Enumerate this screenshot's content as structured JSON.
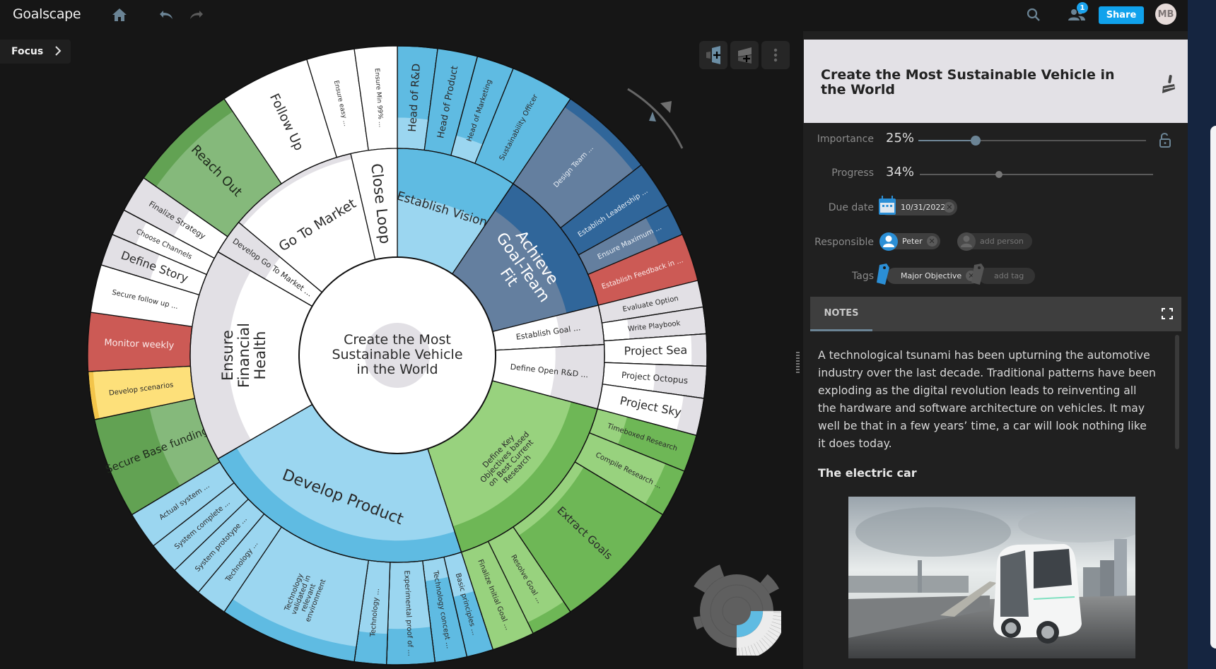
{
  "app": {
    "name": "Goalscape",
    "search_label": "Search",
    "collaborators_badge": "1",
    "share_label": "Share",
    "user_initials": "MB",
    "focus_label": "Focus"
  },
  "toolbar": {
    "add_sibling_label": "Add sibling goal",
    "add_child_label": "Add sub-goal",
    "more_label": "More options"
  },
  "colors": {
    "accent": "#10a2ec",
    "slider": "#6b8495",
    "panel_header": "#e3e1e6",
    "white_seg": "#ffffff",
    "grey_seg": "#e2e0e5",
    "lightblue": "#9bd6f0",
    "blue": "#5fbbe2",
    "steel": "#647f9f",
    "darksteel": "#30669a",
    "red": "#cc5a55",
    "yellow": "#fde07a",
    "yellow_dark": "#f3c54a",
    "green_light": "#98d27e",
    "green": "#6eb756",
    "green_mid": "#85b97b",
    "green_dark": "#62a253"
  },
  "chart_data": {
    "type": "sunburst",
    "title": "Create the Most Sustainable Vehicle in the World",
    "center": {
      "label": "Create the Most Sustainable Vehicle in the World",
      "progress": 34
    },
    "level1": [
      {
        "label": "Establish Vision",
        "start": 0,
        "end": 34,
        "fill": "#5fbbe2",
        "progress_fill": "#9bd6f0",
        "text": "#2a2a2a",
        "font": 17
      },
      {
        "label": "Achieve Goal-Team Fit",
        "start": 34,
        "end": 76,
        "fill": "#30669a",
        "progress_fill": "#647f9f",
        "text": "#ffffff",
        "font": 22
      },
      {
        "label": "Establish Goal ...",
        "start": 76,
        "end": 87,
        "fill": "#e2e0e5",
        "progress_fill": "#ffffff",
        "text": "#2a2a2a",
        "font": 11
      },
      {
        "label": "Define Open R&D ...",
        "start": 87,
        "end": 105,
        "fill": "#e2e0e5",
        "progress_fill": "#ffffff",
        "text": "#2a2a2a",
        "font": 11
      },
      {
        "label": "Define Key Objectives based on Best Current Research",
        "start": 105,
        "end": 162,
        "fill": "#6eb756",
        "progress_fill": "#98d27e",
        "text": "#2a2a2a",
        "font": 11
      },
      {
        "label": "Develop Product",
        "start": 162,
        "end": 240,
        "fill": "#5fbbe2",
        "progress_fill": "#9bd6f0",
        "text": "#2a2a2a",
        "font": 22
      },
      {
        "label": "Ensure Financial Health",
        "start": 240,
        "end": 300,
        "fill": "#e2e0e5",
        "progress_fill": "#ffffff",
        "text": "#2a2a2a",
        "font": 21
      },
      {
        "label": "Develop Go To Market ...",
        "start": 300,
        "end": 310,
        "fill": "#e2e0e5",
        "progress_fill": "#ffffff",
        "text": "#2a2a2a",
        "font": 11
      },
      {
        "label": "Go To Market",
        "start": 310,
        "end": 347,
        "fill": "#e2e0e5",
        "progress_fill": "#ffffff",
        "text": "#2a2a2a",
        "font": 19
      },
      {
        "label": "Close Loop",
        "start": 347,
        "end": 360,
        "fill": "#ffffff",
        "progress_fill": "#ffffff",
        "text": "#2a2a2a",
        "font": 21
      }
    ],
    "level2": [
      {
        "label": "Head of R&D",
        "start": 0,
        "end": 7.5,
        "fill": "#5fbbe2",
        "progress_fill": "#9bd6f0",
        "progress": 30,
        "text": "#2a2a2a",
        "font": 15
      },
      {
        "label": "Head of Product",
        "start": 7.5,
        "end": 15,
        "fill": "#5fbbe2",
        "progress_fill": "#9bd6f0",
        "progress": 0,
        "text": "#2a2a2a",
        "font": 13
      },
      {
        "label": "Head of Marketing",
        "start": 15,
        "end": 22,
        "fill": "#5fbbe2",
        "progress_fill": "#9bd6f0",
        "progress": 20,
        "text": "#2a2a2a",
        "font": 10
      },
      {
        "label": "Sustainability Officer",
        "start": 22,
        "end": 34,
        "fill": "#5fbbe2",
        "progress_fill": "#9bd6f0",
        "progress": 0,
        "text": "#2a2a2a",
        "font": 10
      },
      {
        "label": "Design Team ...",
        "start": 34,
        "end": 52,
        "fill": "#30669a",
        "progress_fill": "#647f9f",
        "progress": 90,
        "text": "#e8eef5",
        "font": 10
      },
      {
        "label": "Establish Leadership ...",
        "start": 52,
        "end": 61,
        "fill": "#30669a",
        "progress_fill": "#647f9f",
        "progress": 0,
        "text": "#e8eef5",
        "font": 10
      },
      {
        "label": "Ensure Maximum ...",
        "start": 61,
        "end": 67,
        "fill": "#30669a",
        "progress_fill": "#647f9f",
        "progress": 75,
        "text": "#e8eef5",
        "font": 10
      },
      {
        "label": "Establish Feedback in ...",
        "start": 67,
        "end": 76,
        "fill": "#cc5a55",
        "progress_fill": "#cc5a55",
        "progress": 0,
        "text": "#fbeaea",
        "font": 10
      },
      {
        "label": "Evaluate Option",
        "start": 76,
        "end": 81,
        "fill": "#e2e0e5",
        "progress_fill": "#ffffff",
        "progress": 0,
        "text": "#2a2a2a",
        "font": 10
      },
      {
        "label": "Write Playbook",
        "start": 81,
        "end": 86,
        "fill": "#e2e0e5",
        "progress_fill": "#ffffff",
        "progress": 25,
        "text": "#2a2a2a",
        "font": 10
      },
      {
        "label": "Project Sea",
        "start": 86,
        "end": 92,
        "fill": "#e2e0e5",
        "progress_fill": "#ffffff",
        "progress": 85,
        "text": "#2a2a2a",
        "font": 16
      },
      {
        "label": "Project Octopus",
        "start": 92,
        "end": 98,
        "fill": "#e2e0e5",
        "progress_fill": "#ffffff",
        "progress": 50,
        "text": "#2a2a2a",
        "font": 12
      },
      {
        "label": "Project Sky",
        "start": 98,
        "end": 105,
        "fill": "#e2e0e5",
        "progress_fill": "#ffffff",
        "progress": 80,
        "text": "#2a2a2a",
        "font": 16
      },
      {
        "label": "Timeboxed Research",
        "start": 105,
        "end": 112,
        "fill": "#6eb756",
        "progress_fill": "#98d27e",
        "progress": 30,
        "text": "#2a2a2a",
        "font": 10
      },
      {
        "label": "Compile Research ...",
        "start": 112,
        "end": 121,
        "fill": "#6eb756",
        "progress_fill": "#98d27e",
        "progress": 80,
        "text": "#2a2a2a",
        "font": 10
      },
      {
        "label": "Extract Goals",
        "start": 121,
        "end": 146,
        "fill": "#6eb756",
        "progress_fill": "#98d27e",
        "progress": 10,
        "text": "#2a2a2a",
        "font": 15
      },
      {
        "label": "Resolve Goal ...",
        "start": 146,
        "end": 154,
        "fill": "#6eb756",
        "progress_fill": "#98d27e",
        "progress": 88,
        "text": "#2a2a2a",
        "font": 10
      },
      {
        "label": "Finalize Initial Goal ...",
        "start": 154,
        "end": 162,
        "fill": "#98d27e",
        "progress_fill": "#98d27e",
        "progress": 100,
        "text": "#2a2a2a",
        "font": 10
      },
      {
        "label": "Basic principles ...",
        "start": 162,
        "end": 167,
        "fill": "#5fbbe2",
        "progress_fill": "#9bd6f0",
        "progress": 40,
        "text": "#2a2a2a",
        "font": 10
      },
      {
        "label": "Technology concept ...",
        "start": 167,
        "end": 173,
        "fill": "#5fbbe2",
        "progress_fill": "#9bd6f0",
        "progress": 20,
        "text": "#2a2a2a",
        "font": 10
      },
      {
        "label": "Experimental proof of ...",
        "start": 173,
        "end": 182,
        "fill": "#5fbbe2",
        "progress_fill": "#9bd6f0",
        "progress": 65,
        "text": "#2a2a2a",
        "font": 10
      },
      {
        "label": "Technology ...",
        "start": 182,
        "end": 188,
        "fill": "#5fbbe2",
        "progress_fill": "#9bd6f0",
        "progress": 70,
        "text": "#2a2a2a",
        "font": 10
      },
      {
        "label": "Technology validated in relevant environment",
        "start": 188,
        "end": 214,
        "fill": "#5fbbe2",
        "progress_fill": "#9bd6f0",
        "progress": 85,
        "text": "#2a2a2a",
        "font": 10
      },
      {
        "label": "Technology ...",
        "start": 214,
        "end": 220,
        "fill": "#9bd6f0",
        "progress_fill": "#9bd6f0",
        "progress": 100,
        "text": "#2a2a2a",
        "font": 10
      },
      {
        "label": "System prototype ...",
        "start": 220,
        "end": 226,
        "fill": "#9bd6f0",
        "progress_fill": "#9bd6f0",
        "progress": 100,
        "text": "#2a2a2a",
        "font": 10
      },
      {
        "label": "System complete ...",
        "start": 226,
        "end": 232,
        "fill": "#9bd6f0",
        "progress_fill": "#9bd6f0",
        "progress": 100,
        "text": "#2a2a2a",
        "font": 10
      },
      {
        "label": "Actual system ...",
        "start": 232,
        "end": 239,
        "fill": "#9bd6f0",
        "progress_fill": "#9bd6f0",
        "progress": 100,
        "text": "#2a2a2a",
        "font": 10
      },
      {
        "label": "Secure Base funding",
        "start": 239,
        "end": 258,
        "fill": "#62a253",
        "progress_fill": "#85b97b",
        "progress": 45,
        "text": "#1f2a1c",
        "font": 15
      },
      {
        "label": "Develop scenarios",
        "start": 258,
        "end": 267,
        "fill": "#f3c54a",
        "progress_fill": "#fde07a",
        "progress": 95,
        "text": "#2a2a2a",
        "font": 10
      },
      {
        "label": "Monitor weekly",
        "start": 267,
        "end": 278,
        "fill": "#cc5a55",
        "progress_fill": "#cc5a55",
        "progress": 0,
        "text": "#fbeaea",
        "font": 13
      },
      {
        "label": "Secure follow up ...",
        "start": 278,
        "end": 287,
        "fill": "#ffffff",
        "progress_fill": "#ffffff",
        "progress": 0,
        "text": "#2a2a2a",
        "font": 10
      },
      {
        "label": "Define Story",
        "start": 287,
        "end": 293,
        "fill": "#e2e0e5",
        "progress_fill": "#ffffff",
        "progress": 50,
        "text": "#2a2a2a",
        "font": 16
      },
      {
        "label": "Choose Channels",
        "start": 293,
        "end": 298,
        "fill": "#e2e0e5",
        "progress_fill": "#ffffff",
        "progress": 75,
        "text": "#2a2a2a",
        "font": 10
      },
      {
        "label": "Finalize Strategy",
        "start": 298,
        "end": 305,
        "fill": "#e2e0e5",
        "progress_fill": "#ffffff",
        "progress": 45,
        "text": "#2a2a2a",
        "font": 11
      },
      {
        "label": "Reach Out",
        "start": 305,
        "end": 326,
        "fill": "#62a253",
        "progress_fill": "#85b97b",
        "progress": 85,
        "text": "#1f2a1c",
        "font": 18
      },
      {
        "label": "Follow Up",
        "start": 326,
        "end": 343,
        "fill": "#ffffff",
        "progress_fill": "#ffffff",
        "progress": 0,
        "text": "#2a2a2a",
        "font": 18
      },
      {
        "label": "Ensure easy ...",
        "start": 343,
        "end": 352,
        "fill": "#ffffff",
        "progress_fill": "#ffffff",
        "progress": 0,
        "text": "#2a2a2a",
        "font": 9
      },
      {
        "label": "Ensure Min 99% ...",
        "start": 352,
        "end": 360,
        "fill": "#ffffff",
        "progress_fill": "#ffffff",
        "progress": 0,
        "text": "#2a2a2a",
        "font": 9
      }
    ],
    "level1_progress": [
      55,
      70,
      60,
      55,
      75,
      80,
      65,
      50,
      95,
      100
    ]
  },
  "panel": {
    "title": "Create the Most Sustainable Vehicle in the World",
    "importance_label": "Importance",
    "importance_value": "25%",
    "importance_fraction": 0.25,
    "progress_label": "Progress",
    "progress_value": "34%",
    "progress_fraction": 0.34,
    "due_label": "Due date",
    "due_value": "10/31/2022",
    "responsible_label": "Responsible",
    "responsible_person": "Peter",
    "add_person_placeholder": "add person",
    "tags_label": "Tags",
    "tag": "Major Objective",
    "add_tag_placeholder": "add tag",
    "notes_tab": "NOTES",
    "notes_paragraph": "A technological tsunami has been upturning the automotive industry over the last decade. Traditional patterns have been exploding as the digital revolution leads to reinventing all the hardware and software architecture on vehicles. It may well be that in a few years’ time, a car will look nothing like it does today.",
    "notes_heading": "The electric car"
  }
}
